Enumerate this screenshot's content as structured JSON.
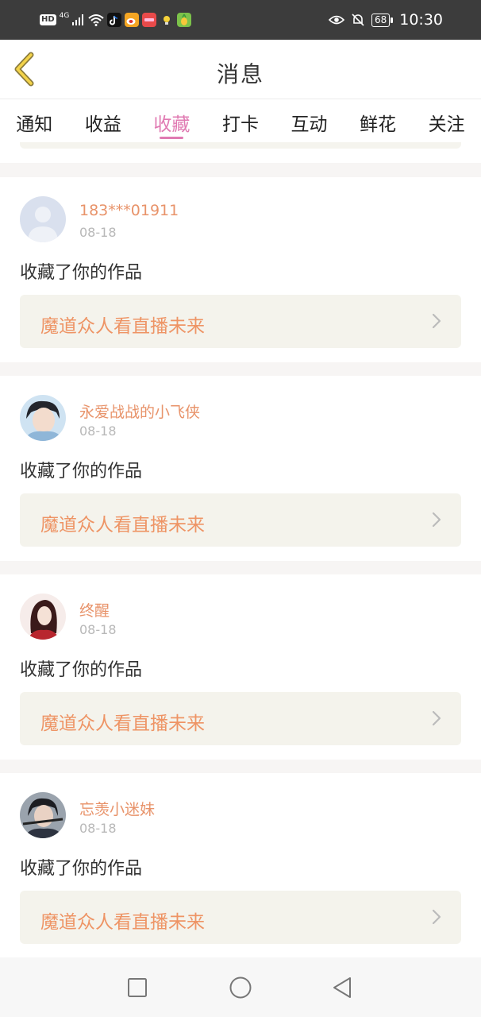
{
  "status_bar": {
    "left_badge": "HD",
    "network": "4G",
    "battery": "68",
    "time": "10:30"
  },
  "header": {
    "title": "消息"
  },
  "tabs": [
    {
      "label": "通知"
    },
    {
      "label": "收益"
    },
    {
      "label": "收藏",
      "active": true
    },
    {
      "label": "打卡"
    },
    {
      "label": "互动"
    },
    {
      "label": "鲜花"
    },
    {
      "label": "关注"
    }
  ],
  "messages": [
    {
      "user": "183***01911",
      "time": "08-18",
      "text": "收藏了你的作品",
      "work": "魔道众人看直播未来"
    },
    {
      "user": "永爱战战的小飞侠",
      "time": "08-18",
      "text": "收藏了你的作品",
      "work": "魔道众人看直播未来"
    },
    {
      "user": "终醒",
      "time": "08-18",
      "text": "收藏了你的作品",
      "work": "魔道众人看直播未来"
    },
    {
      "user": "忘羡小迷妹",
      "time": "08-18",
      "text": "收藏了你的作品",
      "work": "魔道众人看直播未来"
    }
  ],
  "colors": {
    "accent": "#e07ab2",
    "username": "#e8936a",
    "work_title": "#ee9465",
    "card_bg": "#f4f3ec"
  }
}
